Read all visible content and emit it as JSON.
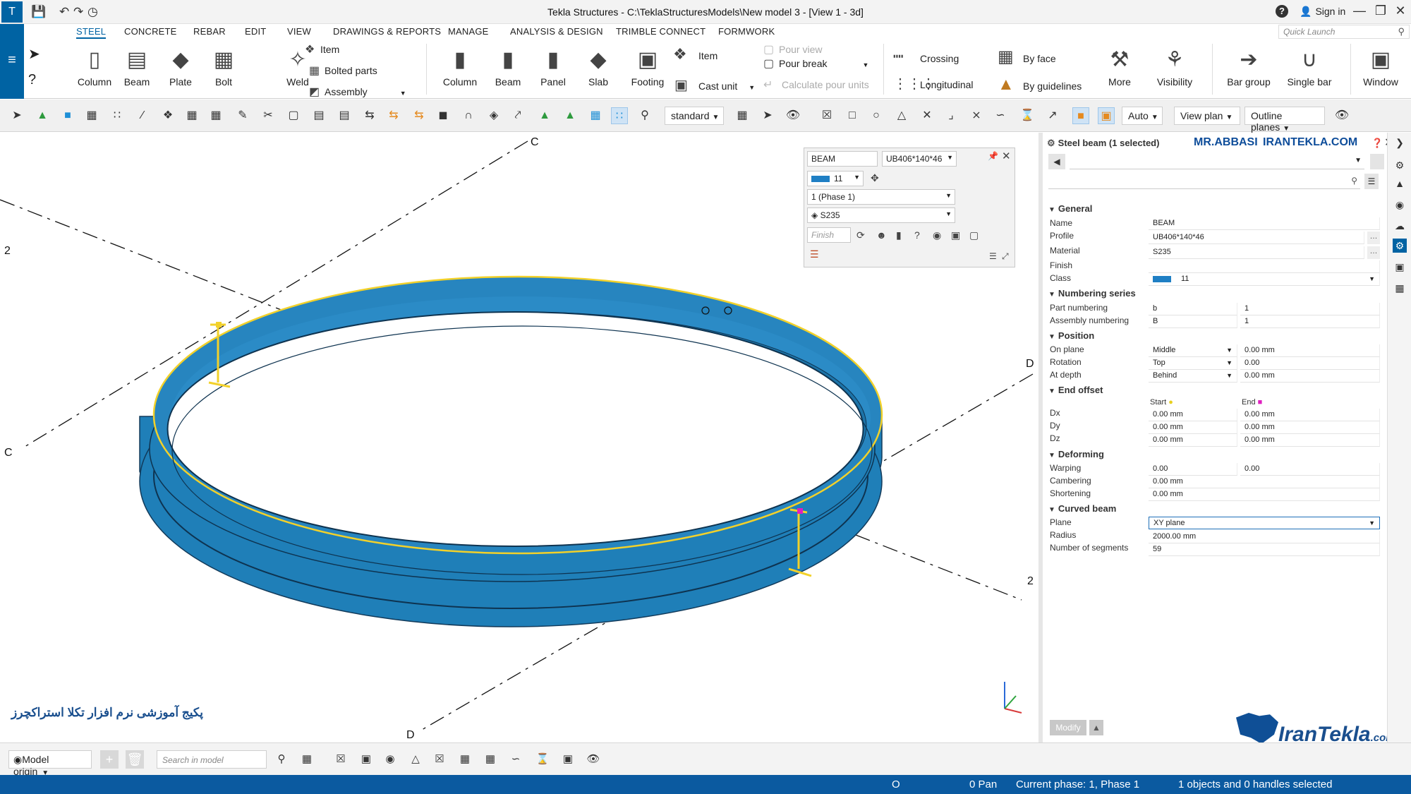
{
  "titlebar": {
    "title": "Tekla Structures - C:\\TeklaStructuresModels\\New model 3  - [View 1 - 3d]",
    "sign_in": "Sign in"
  },
  "ribbon_tabs": [
    "STEEL",
    "CONCRETE",
    "REBAR",
    "EDIT",
    "VIEW",
    "DRAWINGS & REPORTS",
    "MANAGE",
    "ANALYSIS & DESIGN",
    "TRIMBLE CONNECT",
    "FORMWORK"
  ],
  "quick_launch": "Quick Launch",
  "ribbon": {
    "steel_column": "Column",
    "steel_beam": "Beam",
    "steel_plate": "Plate",
    "steel_bolt": "Bolt",
    "steel_weld": "Weld",
    "item": "Item",
    "bolted_parts": "Bolted parts",
    "assembly": "Assembly",
    "conc_column": "Column",
    "conc_beam": "Beam",
    "conc_panel": "Panel",
    "conc_slab": "Slab",
    "conc_footing": "Footing",
    "conc_item": "Item",
    "cast_unit": "Cast unit",
    "pour_view": "Pour view",
    "pour_break": "Pour break",
    "calculate_pour_units": "Calculate pour units",
    "crossing": "Crossing",
    "longitudinal": "Longitudinal",
    "by_face": "By face",
    "by_guidelines": "By guidelines",
    "more": "More",
    "visibility": "Visibility",
    "bar_group": "Bar group",
    "single_bar": "Single bar",
    "window": "Window"
  },
  "toolbar": {
    "standard": "standard",
    "auto": "Auto",
    "view_plane": "View plan",
    "outline_planes": "Outline planes"
  },
  "viewport": {
    "grid_labels": [
      "C",
      "2",
      "C",
      "D",
      "2",
      "D"
    ],
    "watermark_fa": "پکیج آموزشی نرم افزار تکلا استراکچرز"
  },
  "mini": {
    "name": "BEAM",
    "profile": "UB406*140*46",
    "class": "11",
    "phase": "1 (Phase 1)",
    "material": "S235",
    "finish_placeholder": "Finish"
  },
  "props": {
    "title": "Steel beam (1 selected)",
    "watermark_name": "MR.ABBASI",
    "watermark_site": "IRANTEKLA.COM",
    "sections": {
      "general": "General",
      "numbering": "Numbering series",
      "position": "Position",
      "end_offset": "End offset",
      "deforming": "Deforming",
      "curved": "Curved beam"
    },
    "labels": {
      "name": "Name",
      "profile": "Profile",
      "material": "Material",
      "finish": "Finish",
      "class": "Class",
      "part_numbering": "Part numbering",
      "assembly_numbering": "Assembly numbering",
      "on_plane": "On plane",
      "rotation": "Rotation",
      "at_depth": "At depth",
      "start": "Start",
      "end": "End",
      "dx": "Dx",
      "dy": "Dy",
      "dz": "Dz",
      "warping": "Warping",
      "cambering": "Cambering",
      "shortening": "Shortening",
      "plane": "Plane",
      "radius": "Radius",
      "segments": "Number of segments"
    },
    "values": {
      "name": "BEAM",
      "profile": "UB406*140*46",
      "material": "S235",
      "finish": "",
      "class": "11",
      "part_prefix": "b",
      "part_start": "1",
      "assembly_prefix": "B",
      "assembly_start": "1",
      "on_plane": "Middle",
      "on_plane_offset": "0.00 mm",
      "rotation": "Top",
      "rotation_angle": "0.00",
      "at_depth": "Behind",
      "at_depth_offset": "0.00 mm",
      "dx_start": "0.00 mm",
      "dx_end": "0.00 mm",
      "dy_start": "0.00 mm",
      "dy_end": "0.00 mm",
      "dz_start": "0.00 mm",
      "dz_end": "0.00 mm",
      "warping_start": "0.00",
      "warping_end": "0.00",
      "cambering": "0.00 mm",
      "shortening": "0.00 mm",
      "plane": "XY plane",
      "radius": "2000.00 mm",
      "segments": "59"
    },
    "modify": "Modify"
  },
  "bottom": {
    "model_origin": "Model origin",
    "search_placeholder": "Search in model"
  },
  "status": {
    "o": "O",
    "pan": "0  Pan",
    "phase": "Current phase: 1, Phase 1",
    "selection": "1 objects and 0 handles selected"
  },
  "logo": {
    "brand": "IranTekla",
    "tld": ".com"
  },
  "colors": {
    "accent": "#0063a3",
    "beam": "#1f7fb8",
    "highlight": "#f2d12a",
    "status_bar": "#0b5aa0"
  }
}
